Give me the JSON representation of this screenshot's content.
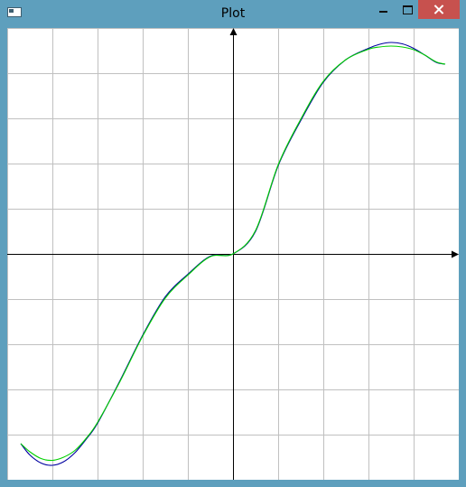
{
  "window": {
    "title": "Plot"
  },
  "chart_data": {
    "type": "line",
    "x_range": [
      -5,
      5
    ],
    "y_range": [
      -5,
      5
    ],
    "grid": true,
    "axes": "center",
    "series": [
      {
        "color": "#0000a0",
        "x": [
          -4.7,
          -4.5,
          -4.25,
          -4,
          -3.75,
          -3.5,
          -3.25,
          -3,
          -2.5,
          -2,
          -1.5,
          -1,
          -0.5,
          0,
          0.5,
          1,
          1.5,
          2,
          2.5,
          3,
          3.25,
          3.5,
          3.75,
          4,
          4.25,
          4.5,
          4.7
        ],
        "y": [
          -4.2,
          -4.45,
          -4.63,
          -4.68,
          -4.6,
          -4.4,
          -4.1,
          -3.75,
          -2.8,
          -1.8,
          -0.95,
          -0.45,
          -0.05,
          0.0,
          0.5,
          1.95,
          2.95,
          3.8,
          4.3,
          4.55,
          4.64,
          4.68,
          4.65,
          4.55,
          4.4,
          4.24,
          4.2
        ]
      },
      {
        "color": "#00d000",
        "x": [
          -4.7,
          -4.5,
          -4.25,
          -4,
          -3.75,
          -3.5,
          -3.25,
          -3,
          -2.5,
          -2,
          -1.5,
          -1,
          -0.5,
          0,
          0.5,
          1,
          1.5,
          2,
          2.5,
          3,
          3.25,
          3.5,
          3.75,
          4,
          4.25,
          4.5,
          4.7
        ],
        "y": [
          -4.2,
          -4.38,
          -4.53,
          -4.57,
          -4.5,
          -4.35,
          -4.08,
          -3.73,
          -2.82,
          -1.82,
          -0.98,
          -0.47,
          -0.06,
          0.0,
          0.52,
          1.97,
          2.98,
          3.82,
          4.3,
          4.53,
          4.58,
          4.6,
          4.58,
          4.52,
          4.4,
          4.25,
          4.2
        ]
      }
    ]
  }
}
